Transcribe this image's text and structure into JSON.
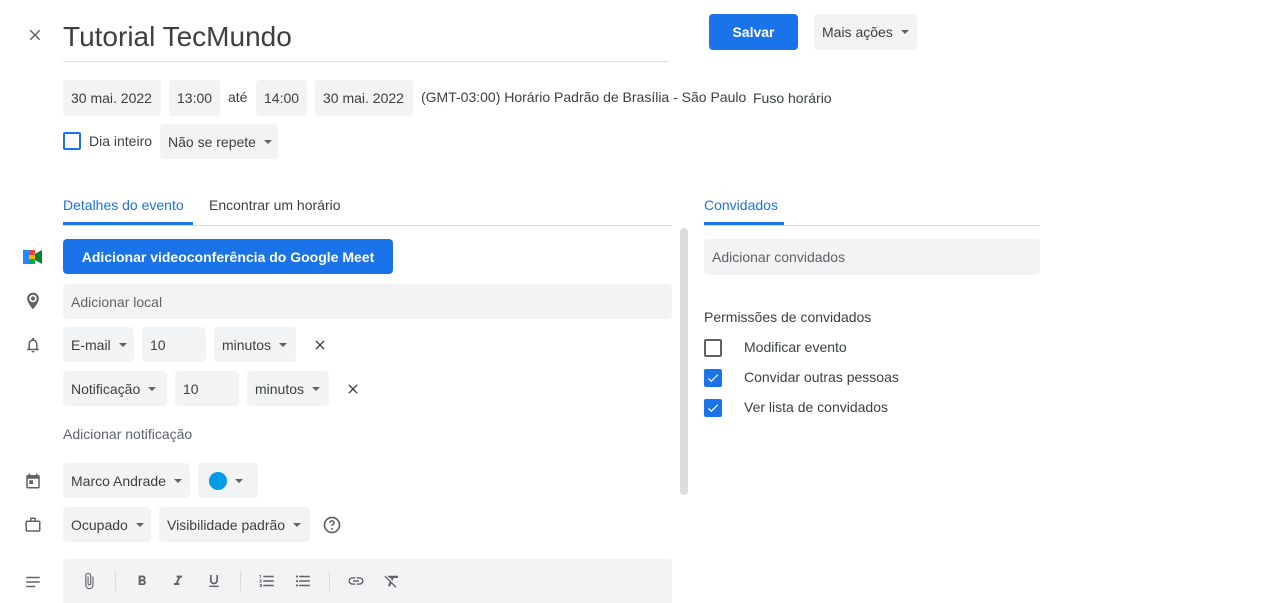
{
  "header": {
    "title": "Tutorial TecMundo",
    "save_label": "Salvar",
    "more_actions_label": "Mais ações"
  },
  "datetime": {
    "start_date": "30 mai. 2022",
    "start_time": "13:00",
    "until_label": "até",
    "end_time": "14:00",
    "end_date": "30 mai. 2022",
    "timezone_text": "(GMT-03:00) Horário Padrão de Brasília - São Paulo",
    "timezone_link": "Fuso horário"
  },
  "options": {
    "all_day_label": "Dia inteiro",
    "all_day_checked": false,
    "repeat_label": "Não se repete"
  },
  "tabs": {
    "details": "Detalhes do evento",
    "find_time": "Encontrar um horário",
    "guests": "Convidados"
  },
  "details": {
    "meet_button": "Adicionar videoconferência do Google Meet",
    "location_placeholder": "Adicionar local",
    "notifications": [
      {
        "type": "E-mail",
        "value": "10",
        "unit": "minutos"
      },
      {
        "type": "Notificação",
        "value": "10",
        "unit": "minutos"
      }
    ],
    "add_notification": "Adicionar notificação",
    "calendar_owner": "Marco Andrade",
    "calendar_color": "#039be5",
    "busy_status": "Ocupado",
    "visibility": "Visibilidade padrão"
  },
  "guests": {
    "add_placeholder": "Adicionar convidados",
    "permissions_title": "Permissões de convidados",
    "permissions": [
      {
        "label": "Modificar evento",
        "checked": false
      },
      {
        "label": "Convidar outras pessoas",
        "checked": true
      },
      {
        "label": "Ver lista de convidados",
        "checked": true
      }
    ]
  },
  "colors": {
    "accent": "#1a73e8",
    "field_bg": "#f1f3f4",
    "text": "#3c4043"
  }
}
